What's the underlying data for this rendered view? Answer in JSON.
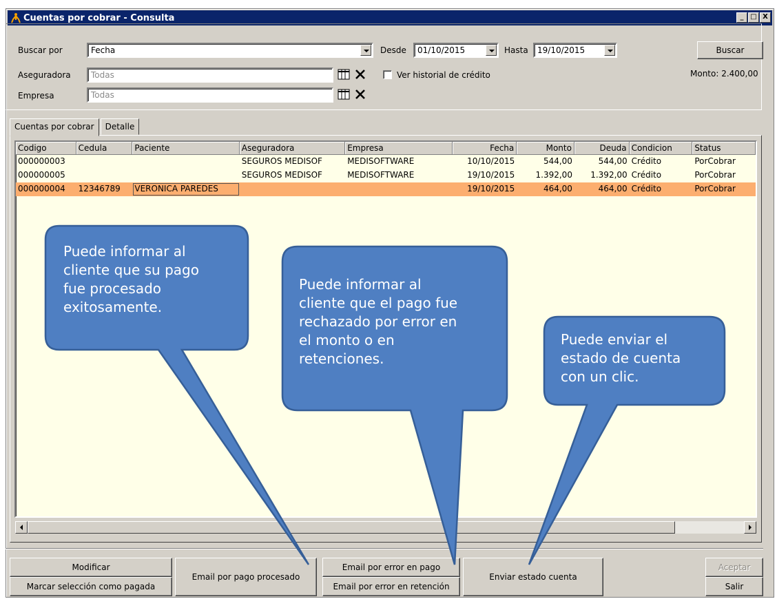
{
  "window": {
    "title": "Cuentas por cobrar - Consulta",
    "controls": [
      "_",
      "□",
      "X"
    ]
  },
  "filters": {
    "buscar_por_label": "Buscar por",
    "buscar_por_value": "Fecha",
    "desde_label": "Desde",
    "desde_value": "01/10/2015",
    "hasta_label": "Hasta",
    "hasta_value": "19/10/2015",
    "buscar_button": "Buscar",
    "aseguradora_label": "Aseguradora",
    "aseguradora_placeholder": "Todas",
    "empresa_label": "Empresa",
    "empresa_placeholder": "Todas",
    "ver_historial_label": "Ver historial de crédito",
    "monto_label": "Monto: 2.400,00"
  },
  "tabs": [
    "Cuentas por cobrar",
    "Detalle"
  ],
  "table": {
    "columns": [
      "Codigo",
      "Cedula",
      "Paciente",
      "Aseguradora",
      "Empresa",
      "Fecha",
      "Monto",
      "Deuda",
      "Condicion",
      "Status"
    ],
    "rows": [
      [
        "000000003",
        "",
        "",
        "SEGUROS MEDISOF",
        "MEDISOFTWARE",
        "10/10/2015",
        "544,00",
        "544,00",
        "Crédito",
        "PorCobrar"
      ],
      [
        "000000005",
        "",
        "",
        "SEGUROS MEDISOF",
        "MEDISOFTWARE",
        "19/10/2015",
        "1.392,00",
        "1.392,00",
        "Crédito",
        "PorCobrar"
      ],
      [
        "000000004",
        "12346789",
        "VERONICA PAREDES",
        "",
        "",
        "19/10/2015",
        "464,00",
        "464,00",
        "Crédito",
        "PorCobrar"
      ]
    ]
  },
  "buttons": {
    "modificar": "Modificar",
    "marcar_pagada": "Marcar selección como pagada",
    "email_procesado": "Email por pago procesado",
    "email_error_pago": "Email por error en pago",
    "email_error_retencion": "Email por error en retención",
    "enviar_estado": "Enviar estado cuenta",
    "aceptar": "Aceptar",
    "salir": "Salir"
  },
  "callouts": {
    "c1": "Puede informar al\ncliente que su pago\nfue procesado\nexitosamente.",
    "c2": "Puede informar al\ncliente que el pago fue\nrechazado por error en\nel monto o en\nretenciones.",
    "c3": "Puede enviar el\nestado de cuenta\ncon un clic."
  },
  "colors": {
    "callout_fill": "#4f7fc2",
    "callout_stroke": "#365f98",
    "selected_row": "#fcae6f",
    "title_bar": "#0a246a"
  }
}
